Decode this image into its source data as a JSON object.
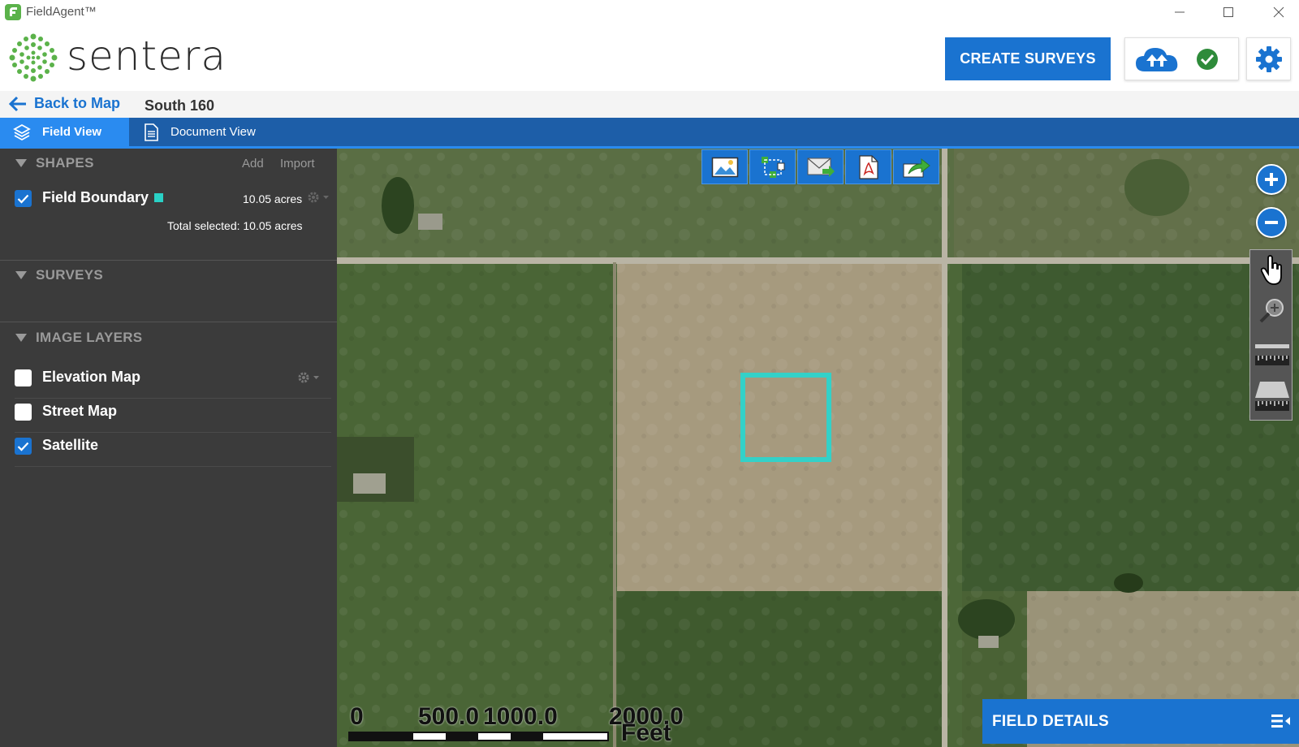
{
  "window": {
    "title": "FieldAgent™"
  },
  "header": {
    "logo_text": "sentera",
    "create_surveys_label": "CREATE SURVEYS",
    "colors": {
      "accent": "#1a73d0",
      "check": "#2e8b3a"
    }
  },
  "breadcrumb": {
    "back_label": "Back to Map",
    "current": "South 160"
  },
  "view_tabs": [
    {
      "label": "Field View",
      "active": true
    },
    {
      "label": "Document View",
      "active": false
    }
  ],
  "sidebar": {
    "shapes": {
      "title": "SHAPES",
      "add_label": "Add",
      "import_label": "Import",
      "items": [
        {
          "label": "Field Boundary",
          "value": "10.05 acres",
          "checked": true,
          "color": "#2ad1c6"
        }
      ],
      "total_text": "Total selected: 10.05 acres"
    },
    "surveys": {
      "title": "SURVEYS"
    },
    "image_layers": {
      "title": "IMAGE LAYERS",
      "items": [
        {
          "label": "Elevation Map",
          "checked": false
        },
        {
          "label": "Street Map",
          "checked": false
        },
        {
          "label": "Satellite",
          "checked": true
        }
      ]
    }
  },
  "map": {
    "toolbar_icons": [
      "image-icon",
      "layers-select-icon",
      "email-icon",
      "pdf-icon",
      "share-icon"
    ],
    "scale_labels": [
      "0",
      "500.0",
      "1000.0",
      "2000.0"
    ],
    "scale_unit": "Feet",
    "boundary_color": "#33d1c8"
  },
  "field_details": {
    "label": "FIELD DETAILS"
  }
}
